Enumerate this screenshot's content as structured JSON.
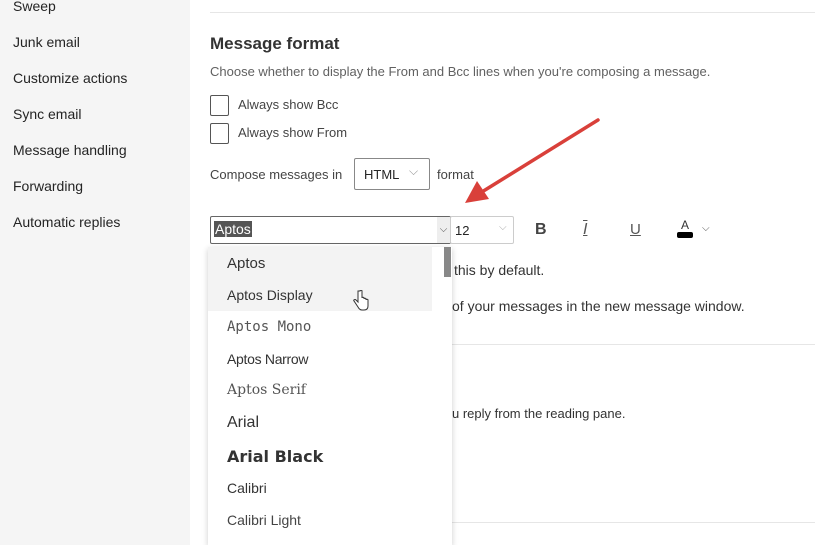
{
  "sidebar": {
    "items": [
      "Sweep",
      "Junk email",
      "Customize actions",
      "Sync email",
      "Message handling",
      "Forwarding",
      "Automatic replies"
    ]
  },
  "section": {
    "title": "Message format",
    "description": "Choose whether to display the From and Bcc lines when you're composing a message.",
    "checkboxes": [
      "Always show Bcc",
      "Always show From"
    ],
    "compose_prefix": "Compose messages in",
    "compose_value": "HTML",
    "compose_suffix": "format"
  },
  "toolbar": {
    "font": "Aptos",
    "size": "12",
    "bold": "B",
    "italic": "I",
    "underline": "U",
    "color": "A"
  },
  "fonts": [
    "Aptos",
    "Aptos Display",
    "Aptos Mono",
    "Aptos Narrow",
    "Aptos Serif",
    "Arial",
    "Arial Black",
    "Calibri",
    "Calibri Light"
  ],
  "body_text": {
    "line1": "this by default.",
    "line2": "of your messages in the new message window.",
    "line3": "u reply from the reading pane."
  },
  "arrow_color": "#d9403a"
}
